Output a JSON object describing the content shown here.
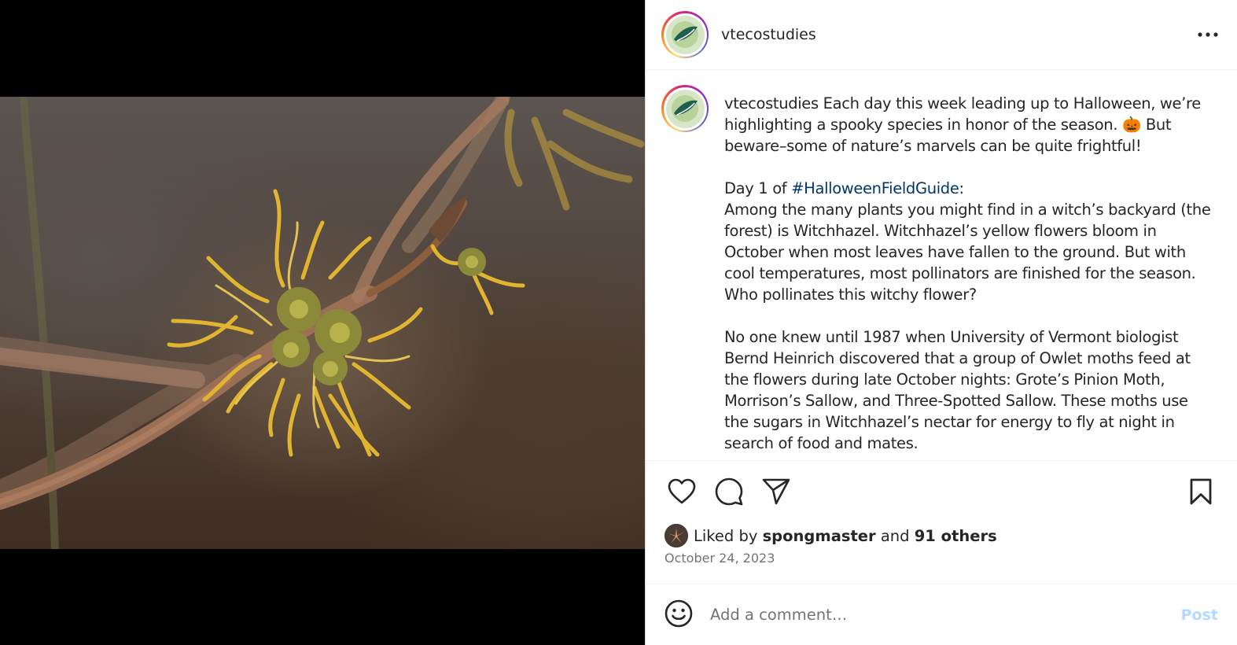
{
  "post": {
    "account": "vtecostudies",
    "caption": {
      "username": "vtecostudies",
      "intro_line1": "Each day this week leading up to Halloween, we’re",
      "intro_line2": "highlighting a spooky species in honor of the season.",
      "emoji": "🎃",
      "intro_line2b": "But",
      "intro_line3": "beware–some of nature’s marvels can be quite frightful!",
      "day_prefix": "Day 1 of",
      "hashtag": "#HalloweenFieldGuide",
      "day_suffix": ":",
      "para1": [
        "Among the many plants you might find in a witch’s backyard (the",
        "forest) is Witchhazel. Witchhazel’s yellow flowers bloom in",
        "October when most leaves have fallen to the ground. But with",
        "cool temperatures, most pollinators are finished for the season.",
        "Who pollinates this witchy flower?"
      ],
      "para2": [
        "No one knew until 1987 when University of Vermont biologist",
        "Bernd Heinrich discovered that a group of Owlet moths feed at",
        "the flowers during late October nights: Grote’s Pinion Moth,",
        "Morrison’s Sallow, and Three-Spotted Sallow. These moths use",
        "the sugars in Witchhazel’s nectar for energy to fly at night in",
        "search of food and mates."
      ]
    },
    "likes": {
      "prefix": "Liked by",
      "liker": "spongmaster",
      "middle": "and",
      "others": "91 others"
    },
    "date": "October 24, 2023",
    "comment": {
      "placeholder": "Add a comment…",
      "post_label": "Post"
    },
    "icons": {
      "more": "more-options-icon",
      "like": "heart-icon",
      "comment": "comment-icon",
      "share": "send-icon",
      "save": "bookmark-icon",
      "emoji": "smiley-icon"
    },
    "colors": {
      "hashtag": "#00376b",
      "post_disabled": "#b3dbff",
      "secondary_text": "#737373"
    }
  }
}
